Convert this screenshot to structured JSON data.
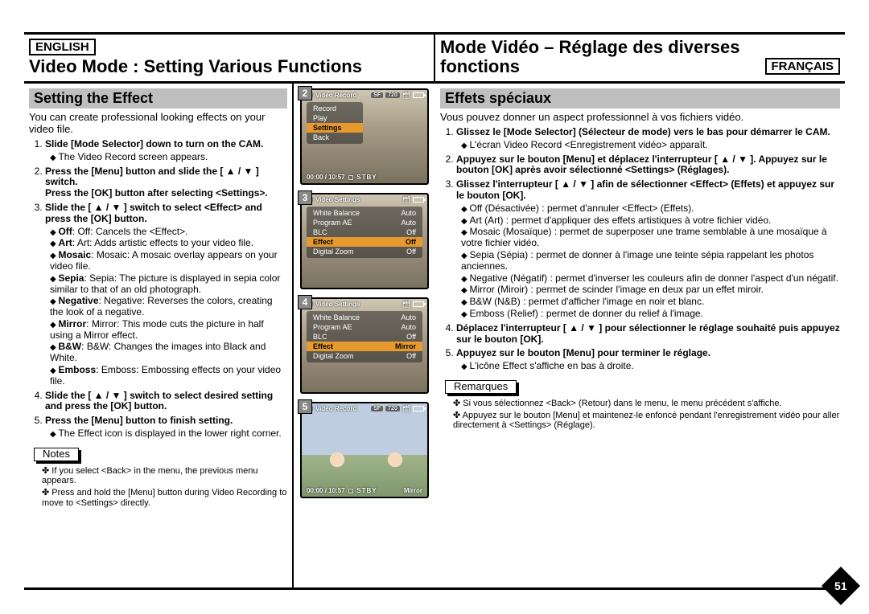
{
  "page_number": "51",
  "langs": {
    "left": "ENGLISH",
    "right": "FRANÇAIS"
  },
  "titles": {
    "left": "Video Mode : Setting Various Functions",
    "right": "Mode Vidéo – Réglage des diverses fonctions"
  },
  "sections": {
    "left": "Setting the Effect",
    "right": "Effets spéciaux"
  },
  "intro": {
    "left": "You can create professional looking effects on your video file.",
    "right": "Vous pouvez donner un aspect professionnel à vos fichiers vidéo."
  },
  "left_steps": {
    "s1": "Slide [Mode Selector] down to turn on the CAM.",
    "s1_a": "The Video Record screen appears.",
    "s2": "Press the [Menu] button and slide the [ ▲ / ▼ ] switch.\nPress the [OK] button after selecting <Settings>.",
    "s3": "Slide the [ ▲ / ▼ ] switch to select <Effect> and press the [OK] button.",
    "s3_items": {
      "off": "Off: Cancels the <Effect>.",
      "art": "Art: Adds artistic effects to your video file.",
      "mosaic": "Mosaic: A mosaic overlay appears on your video file.",
      "sepia": "Sepia: The picture is displayed in sepia color similar to that of an old photograph.",
      "negative": "Negative: Reverses the colors, creating the look of a negative.",
      "mirror": "Mirror: This mode cuts the picture in half using a Mirror effect.",
      "bw": "B&W: Changes the images into Black and White.",
      "emboss": "Emboss: Embossing effects on your video file."
    },
    "s4": "Slide the [ ▲ / ▼ ] switch to select desired setting and press the [OK] button.",
    "s5": "Press the [Menu] button to finish setting.",
    "s5_a": "The Effect icon is displayed in the lower right corner."
  },
  "right_steps": {
    "s1": "Glissez le [Mode Selector] (Sélecteur de mode) vers le bas pour démarrer le CAM.",
    "s1_a": "L'écran Video Record <Enregistrement vidéo> apparaît.",
    "s2": "Appuyez sur le bouton [Menu] et déplacez l'interrupteur [ ▲ / ▼ ]. Appuyez sur le bouton [OK] après avoir sélectionné <Settings> (Réglages).",
    "s3": "Glissez l'interrupteur [ ▲ / ▼ ] afin de sélectionner <Effect> (Effets) et appuyez sur le bouton [OK].",
    "s3_items": {
      "off": "Off (Désactivée) : permet d'annuler <Effect> (Effets).",
      "art": "Art (Art) : permet d'appliquer des effets artistiques à votre fichier vidéo.",
      "mosaic": "Mosaic (Mosaïque) : permet de superposer une trame semblable à une mosaïque à votre fichier vidéo.",
      "sepia": "Sepia (Sépia) : permet de donner à l'image une teinte sépia rappelant les photos anciennes.",
      "negative": "Negative (Négatif) : permet d'inverser les couleurs afin de donner l'aspect d'un négatif.",
      "mirror": "Mirror (Miroir) : permet de scinder l'image en deux par un effet miroir.",
      "bw": "B&W (N&B) : permet d'afficher l'image en noir et blanc.",
      "emboss": "Emboss (Relief) : permet de donner du relief à l'image."
    },
    "s4": "Déplacez l'interrupteur [ ▲ / ▼ ] pour sélectionner le réglage souhaité puis appuyez sur le bouton [OK].",
    "s5": "Appuyez sur le bouton [Menu] pour terminer le réglage.",
    "s5_a": "L'icône Effect s'affiche en bas à droite."
  },
  "notes_label": {
    "left": "Notes",
    "right": "Remarques"
  },
  "notes": {
    "left": {
      "n1": "If you select <Back> in the menu, the previous menu appears.",
      "n2": "Press and hold the [Menu] button during Video Recording to move to <Settings> directly."
    },
    "right": {
      "n1": "Si vous sélectionnez <Back> (Retour) dans le menu, le menu précédent s'affiche.",
      "n2": "Appuyez sur le bouton [Menu] et maintenez-le enfoncé pendant l'enregistrement vidéo pour aller directement à <Settings> (Réglage)."
    }
  },
  "shots": {
    "s2": {
      "num": "2",
      "title": "Video Record",
      "sf": "SF",
      "size": "720",
      "menu": [
        "Record",
        "Play",
        "Settings",
        "Back"
      ],
      "time": "00:00 / 10:57",
      "status": "STBY"
    },
    "s3": {
      "num": "3",
      "title": "Video Settings",
      "rows": [
        [
          "White Balance",
          "Auto"
        ],
        [
          "Program AE",
          "Auto"
        ],
        [
          "BLC",
          "Off"
        ],
        [
          "Effect",
          "Off"
        ],
        [
          "Digital Zoom",
          "Off"
        ]
      ],
      "sel_idx": 3
    },
    "s4": {
      "num": "4",
      "title": "Video Settings",
      "rows": [
        [
          "White Balance",
          "Auto"
        ],
        [
          "Program AE",
          "Auto"
        ],
        [
          "BLC",
          "Off"
        ],
        [
          "Effect",
          "Mirror"
        ],
        [
          "Digital Zoom",
          "Off"
        ]
      ],
      "sel_idx": 3
    },
    "s5": {
      "num": "5",
      "title": "Video Record",
      "sf": "SF",
      "size": "720",
      "time": "00:00 / 10:57",
      "status": "STBY",
      "effect": "Mirror"
    }
  }
}
